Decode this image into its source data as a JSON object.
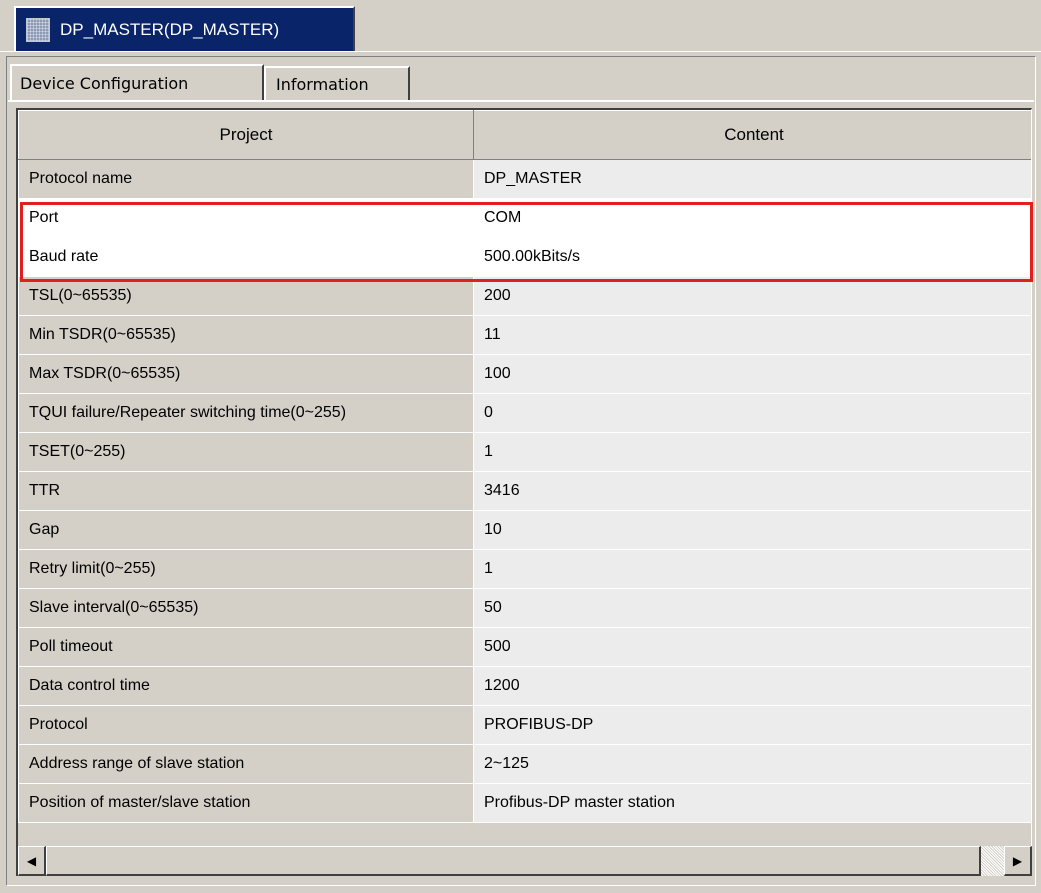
{
  "window": {
    "tab_title": "DP_MASTER(DP_MASTER)"
  },
  "tabs": [
    {
      "label": "Device Configuration",
      "active": true
    },
    {
      "label": "Information",
      "active": false
    }
  ],
  "table": {
    "columns": [
      "Project",
      "Content"
    ],
    "rows": [
      {
        "project": "Protocol name",
        "content": "DP_MASTER"
      },
      {
        "project": "Port",
        "content": "COM"
      },
      {
        "project": "Baud rate",
        "content": "500.00kBits/s"
      },
      {
        "project": "TSL(0~65535)",
        "content": "200"
      },
      {
        "project": "Min TSDR(0~65535)",
        "content": "11"
      },
      {
        "project": "Max TSDR(0~65535)",
        "content": "100"
      },
      {
        "project": "TQUI failure/Repeater switching time(0~255)",
        "content": "0"
      },
      {
        "project": "TSET(0~255)",
        "content": "1"
      },
      {
        "project": "TTR",
        "content": "3416"
      },
      {
        "project": "Gap",
        "content": "10"
      },
      {
        "project": "Retry limit(0~255)",
        "content": "1"
      },
      {
        "project": "Slave interval(0~65535)",
        "content": "50"
      },
      {
        "project": "Poll timeout",
        "content": "500"
      },
      {
        "project": "Data control time",
        "content": "1200"
      },
      {
        "project": "Protocol",
        "content": "PROFIBUS-DP"
      },
      {
        "project": "Address range of slave station",
        "content": "2~125"
      },
      {
        "project": "Position of master/slave station",
        "content": "Profibus-DP master station"
      }
    ]
  },
  "highlight": {
    "color": "#e02020"
  },
  "scrollbar": {
    "left_icon": "left-arrow-icon",
    "right_icon": "right-arrow-icon"
  }
}
